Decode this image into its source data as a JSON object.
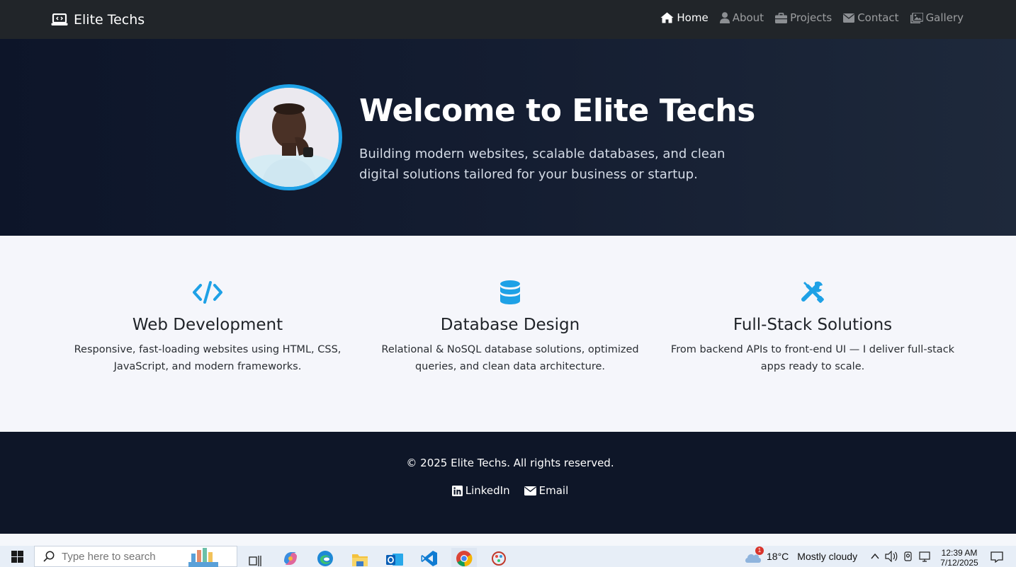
{
  "navbar": {
    "brand": "Elite Techs",
    "items": [
      {
        "label": "Home",
        "icon": "home-icon",
        "active": true
      },
      {
        "label": "About",
        "icon": "user-icon",
        "active": false
      },
      {
        "label": "Projects",
        "icon": "briefcase-icon",
        "active": false
      },
      {
        "label": "Contact",
        "icon": "envelope-icon",
        "active": false
      },
      {
        "label": "Gallery",
        "icon": "images-icon",
        "active": false
      }
    ]
  },
  "hero": {
    "title": "Welcome to Elite Techs",
    "subtitle": "Building modern websites, scalable databases, and clean digital solutions tailored for your business or startup."
  },
  "features": [
    {
      "icon": "code-icon",
      "title": "Web Development",
      "text": "Responsive, fast-loading websites using HTML, CSS, JavaScript, and modern frameworks."
    },
    {
      "icon": "database-icon",
      "title": "Database Design",
      "text": "Relational & NoSQL database solutions, optimized queries, and clean data architecture."
    },
    {
      "icon": "tools-icon",
      "title": "Full-Stack Solutions",
      "text": "From backend APIs to front-end UI — I deliver full-stack apps ready to scale."
    }
  ],
  "footer": {
    "copyright": "© 2025 Elite Techs. All rights reserved.",
    "links": [
      {
        "label": "LinkedIn",
        "icon": "linkedin-icon"
      },
      {
        "label": "Email",
        "icon": "envelope-icon"
      }
    ]
  },
  "taskbar": {
    "search_placeholder": "Type here to search",
    "weather_temp": "18°C",
    "weather_desc": "Mostly cloudy",
    "weather_badge": "1",
    "time": "12:39 AM",
    "date": "7/12/2025"
  },
  "colors": {
    "accent": "#1ea1e6",
    "navbar": "#212529",
    "hero_dark": "#0d1529",
    "footer": "#0e1628"
  }
}
